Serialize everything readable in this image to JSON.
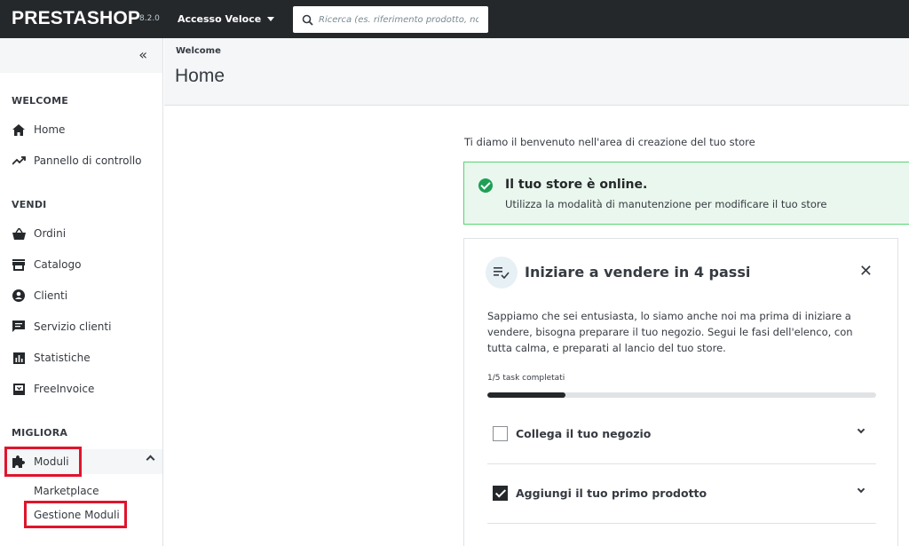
{
  "topbar": {
    "logo": "PRESTASHOP",
    "version": "8.2.0",
    "quick_access": "Accesso Veloce",
    "search_placeholder": "Ricerca (es. riferimento prodotto, nom"
  },
  "sidebar": {
    "collapse_icon": "chevrons-left-icon",
    "sections": {
      "welcome": "WELCOME",
      "vendi": "VENDI",
      "migliora": "MIGLIORA"
    },
    "items": {
      "home": "Home",
      "dashboard": "Pannello di controllo",
      "orders": "Ordini",
      "catalog": "Catalogo",
      "customers": "Clienti",
      "customer_service": "Servizio clienti",
      "stats": "Statistiche",
      "freeinvoice": "FreeInvoice",
      "modules": "Moduli"
    },
    "sub_items": {
      "marketplace": "Marketplace",
      "module_manager": "Gestione Moduli"
    },
    "highlight_color": "#e0142c"
  },
  "header": {
    "breadcrumb": "Welcome",
    "title": "Home"
  },
  "main": {
    "welcome_text": "Ti diamo il benvenuto nell'area di creazione del tuo store",
    "alert": {
      "title": "Il tuo store è online.",
      "text": "Utilizza la modalità di manutenzione per modificare il tuo store",
      "color": "#1f9f56"
    },
    "card": {
      "title": "Iniziare a vendere in 4 passi",
      "description": "Sappiamo che sei entusiasta, lo siamo anche noi ma prima di iniziare a vendere, bisogna preparare il tuo negozio. Segui le fasi dell'elenco, con tutta calma, e preparati al lancio del tuo store.",
      "progress_label": "1/5 task completati",
      "progress_fraction": 0.2,
      "tasks": [
        {
          "label": "Collega il tuo negozio",
          "checked": false
        },
        {
          "label": "Aggiungi il tuo primo prodotto",
          "checked": true
        }
      ]
    }
  }
}
